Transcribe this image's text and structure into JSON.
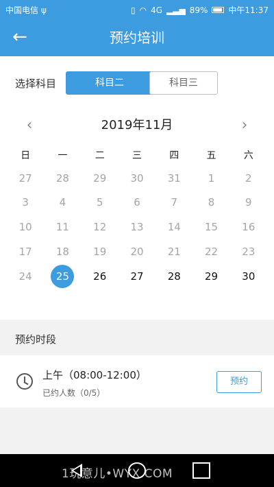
{
  "status_bar": {
    "carrier": "中国电信",
    "usb_symbol": "ψ",
    "network": "4G",
    "battery_percent": "89%",
    "time": "中午11:37"
  },
  "header": {
    "back_icon": "arrow-left-icon",
    "title": "预约培训"
  },
  "subject": {
    "label": "选择科目",
    "options": [
      "科目二",
      "科目三"
    ],
    "selected": "科目二"
  },
  "calendar": {
    "month_label": "2019年11月",
    "weekdays": [
      "日",
      "一",
      "二",
      "三",
      "四",
      "五",
      "六"
    ],
    "weeks": [
      [
        "27",
        "28",
        "29",
        "30",
        "31",
        "1",
        "2"
      ],
      [
        "3",
        "4",
        "5",
        "6",
        "7",
        "8",
        "9"
      ],
      [
        "10",
        "11",
        "12",
        "13",
        "14",
        "15",
        "16"
      ],
      [
        "17",
        "18",
        "19",
        "20",
        "21",
        "22",
        "23"
      ],
      [
        "24",
        "25",
        "26",
        "27",
        "28",
        "29",
        "30"
      ]
    ],
    "selected_day": "25"
  },
  "slots": {
    "title": "预约时段",
    "items": [
      {
        "time": "上午（08:00-12:00）",
        "count": "已约人数（0/5）",
        "button": "预约"
      }
    ]
  },
  "watermark": "1玩意儿•WYX.COM",
  "colors": {
    "primary": "#3d9be0",
    "background_section": "#f2f2f2"
  }
}
